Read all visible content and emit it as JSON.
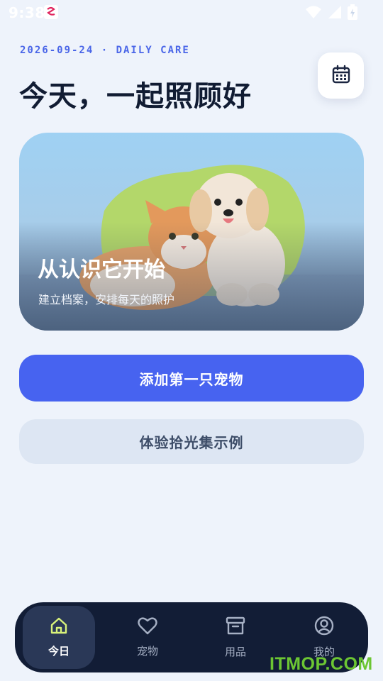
{
  "status_bar": {
    "time": "9:38",
    "icons": [
      "app-notification-icon",
      "wifi-icon",
      "battery-icon"
    ]
  },
  "header": {
    "date_line": "2026-09-24 · DAILY CARE",
    "title": "今天，一起照顾好",
    "calendar_icon": "calendar-icon"
  },
  "hero": {
    "title": "从认识它开始",
    "subtitle": "建立档案，安排每天的照护",
    "image": "cat-and-dog-photo"
  },
  "actions": {
    "primary_label": "添加第一只宠物",
    "secondary_label": "体验拾光集示例"
  },
  "nav": {
    "items": [
      {
        "label": "今日",
        "icon": "home-icon",
        "active": true
      },
      {
        "label": "宠物",
        "icon": "heart-icon",
        "active": false
      },
      {
        "label": "用品",
        "icon": "archive-box-icon",
        "active": false
      },
      {
        "label": "我的",
        "icon": "user-circle-icon",
        "active": false
      }
    ]
  },
  "watermark": "ITMOP.COM",
  "colors": {
    "background": "#eef3fb",
    "accent": "#4763f0",
    "active_nav_icon": "#d8f27a",
    "nav_background": "#121d36"
  }
}
